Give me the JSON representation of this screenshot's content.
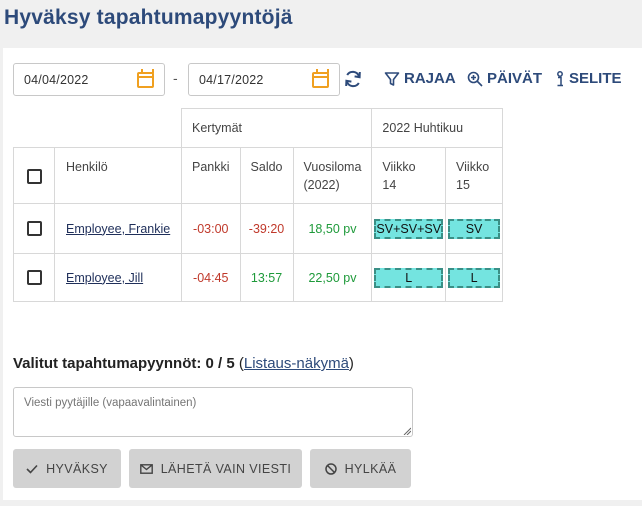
{
  "page": {
    "title": "Hyväksy tapahtumapyyntöjä"
  },
  "filters": {
    "start_date": "04/04/2022",
    "separator": "-",
    "end_date": "04/17/2022",
    "rajaa_label": "RAJAA",
    "paivat_label": "PÄIVÄT",
    "selite_label": "SELITE"
  },
  "table": {
    "group_kertymat": "Kertymät",
    "group_month": "2022 Huhtikuu",
    "col_henkilo": "Henkilö",
    "col_pankki": "Pankki",
    "col_saldo": "Saldo",
    "col_vuosiloma_line1": "Vuosiloma",
    "col_vuosiloma_line2": "(2022)",
    "col_week1_line1": "Viikko",
    "col_week1_line2": "14",
    "col_week2_line1": "Viikko",
    "col_week2_line2": "15",
    "rows": [
      {
        "name": "Employee, Frankie",
        "pankki": "-03:00",
        "saldo": "-39:20",
        "vuosiloma": "18,50 pv",
        "week14": "SV+SV+SV",
        "week15": "SV"
      },
      {
        "name": "Employee, Jill",
        "pankki": "-04:45",
        "saldo": "13:57",
        "vuosiloma": "22,50 pv",
        "week14": "L",
        "week15": "L"
      }
    ]
  },
  "selection": {
    "label": "Valitut tapahtumapyynnöt: 0 / 5",
    "open_paren": " (",
    "link": "Listaus-näkymä",
    "close_paren": ")"
  },
  "message": {
    "placeholder": "Viesti pyytäjille (vapaavalintainen)"
  },
  "actions": {
    "approve": "HYVÄKSY",
    "send_message": "LÄHETÄ VAIN VIESTI",
    "reject": "HYLKÄÄ"
  },
  "colors": {
    "title": "#2d4a7a",
    "calendar_icon": "#f0a020",
    "negative": "#c0392b",
    "positive": "#1e9a3a",
    "chip_fill": "#74e4e0",
    "chip_border": "#3a8f86",
    "button_bg": "#d2d2d2"
  }
}
